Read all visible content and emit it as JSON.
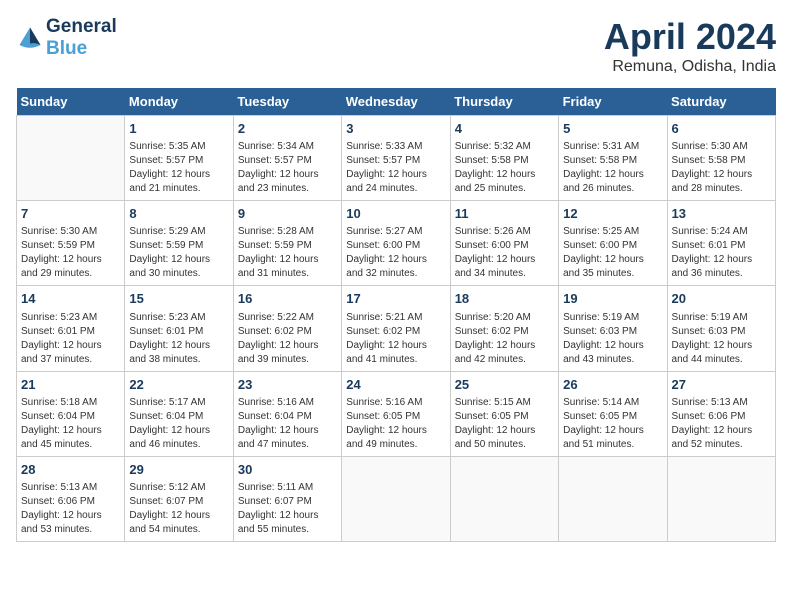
{
  "header": {
    "logo_line1": "General",
    "logo_line2": "Blue",
    "month": "April 2024",
    "location": "Remuna, Odisha, India"
  },
  "days_of_week": [
    "Sunday",
    "Monday",
    "Tuesday",
    "Wednesday",
    "Thursday",
    "Friday",
    "Saturday"
  ],
  "weeks": [
    [
      {
        "num": "",
        "info": ""
      },
      {
        "num": "1",
        "info": "Sunrise: 5:35 AM\nSunset: 5:57 PM\nDaylight: 12 hours\nand 21 minutes."
      },
      {
        "num": "2",
        "info": "Sunrise: 5:34 AM\nSunset: 5:57 PM\nDaylight: 12 hours\nand 23 minutes."
      },
      {
        "num": "3",
        "info": "Sunrise: 5:33 AM\nSunset: 5:57 PM\nDaylight: 12 hours\nand 24 minutes."
      },
      {
        "num": "4",
        "info": "Sunrise: 5:32 AM\nSunset: 5:58 PM\nDaylight: 12 hours\nand 25 minutes."
      },
      {
        "num": "5",
        "info": "Sunrise: 5:31 AM\nSunset: 5:58 PM\nDaylight: 12 hours\nand 26 minutes."
      },
      {
        "num": "6",
        "info": "Sunrise: 5:30 AM\nSunset: 5:58 PM\nDaylight: 12 hours\nand 28 minutes."
      }
    ],
    [
      {
        "num": "7",
        "info": "Sunrise: 5:30 AM\nSunset: 5:59 PM\nDaylight: 12 hours\nand 29 minutes."
      },
      {
        "num": "8",
        "info": "Sunrise: 5:29 AM\nSunset: 5:59 PM\nDaylight: 12 hours\nand 30 minutes."
      },
      {
        "num": "9",
        "info": "Sunrise: 5:28 AM\nSunset: 5:59 PM\nDaylight: 12 hours\nand 31 minutes."
      },
      {
        "num": "10",
        "info": "Sunrise: 5:27 AM\nSunset: 6:00 PM\nDaylight: 12 hours\nand 32 minutes."
      },
      {
        "num": "11",
        "info": "Sunrise: 5:26 AM\nSunset: 6:00 PM\nDaylight: 12 hours\nand 34 minutes."
      },
      {
        "num": "12",
        "info": "Sunrise: 5:25 AM\nSunset: 6:00 PM\nDaylight: 12 hours\nand 35 minutes."
      },
      {
        "num": "13",
        "info": "Sunrise: 5:24 AM\nSunset: 6:01 PM\nDaylight: 12 hours\nand 36 minutes."
      }
    ],
    [
      {
        "num": "14",
        "info": "Sunrise: 5:23 AM\nSunset: 6:01 PM\nDaylight: 12 hours\nand 37 minutes."
      },
      {
        "num": "15",
        "info": "Sunrise: 5:23 AM\nSunset: 6:01 PM\nDaylight: 12 hours\nand 38 minutes."
      },
      {
        "num": "16",
        "info": "Sunrise: 5:22 AM\nSunset: 6:02 PM\nDaylight: 12 hours\nand 39 minutes."
      },
      {
        "num": "17",
        "info": "Sunrise: 5:21 AM\nSunset: 6:02 PM\nDaylight: 12 hours\nand 41 minutes."
      },
      {
        "num": "18",
        "info": "Sunrise: 5:20 AM\nSunset: 6:02 PM\nDaylight: 12 hours\nand 42 minutes."
      },
      {
        "num": "19",
        "info": "Sunrise: 5:19 AM\nSunset: 6:03 PM\nDaylight: 12 hours\nand 43 minutes."
      },
      {
        "num": "20",
        "info": "Sunrise: 5:19 AM\nSunset: 6:03 PM\nDaylight: 12 hours\nand 44 minutes."
      }
    ],
    [
      {
        "num": "21",
        "info": "Sunrise: 5:18 AM\nSunset: 6:04 PM\nDaylight: 12 hours\nand 45 minutes."
      },
      {
        "num": "22",
        "info": "Sunrise: 5:17 AM\nSunset: 6:04 PM\nDaylight: 12 hours\nand 46 minutes."
      },
      {
        "num": "23",
        "info": "Sunrise: 5:16 AM\nSunset: 6:04 PM\nDaylight: 12 hours\nand 47 minutes."
      },
      {
        "num": "24",
        "info": "Sunrise: 5:16 AM\nSunset: 6:05 PM\nDaylight: 12 hours\nand 49 minutes."
      },
      {
        "num": "25",
        "info": "Sunrise: 5:15 AM\nSunset: 6:05 PM\nDaylight: 12 hours\nand 50 minutes."
      },
      {
        "num": "26",
        "info": "Sunrise: 5:14 AM\nSunset: 6:05 PM\nDaylight: 12 hours\nand 51 minutes."
      },
      {
        "num": "27",
        "info": "Sunrise: 5:13 AM\nSunset: 6:06 PM\nDaylight: 12 hours\nand 52 minutes."
      }
    ],
    [
      {
        "num": "28",
        "info": "Sunrise: 5:13 AM\nSunset: 6:06 PM\nDaylight: 12 hours\nand 53 minutes."
      },
      {
        "num": "29",
        "info": "Sunrise: 5:12 AM\nSunset: 6:07 PM\nDaylight: 12 hours\nand 54 minutes."
      },
      {
        "num": "30",
        "info": "Sunrise: 5:11 AM\nSunset: 6:07 PM\nDaylight: 12 hours\nand 55 minutes."
      },
      {
        "num": "",
        "info": ""
      },
      {
        "num": "",
        "info": ""
      },
      {
        "num": "",
        "info": ""
      },
      {
        "num": "",
        "info": ""
      }
    ]
  ]
}
